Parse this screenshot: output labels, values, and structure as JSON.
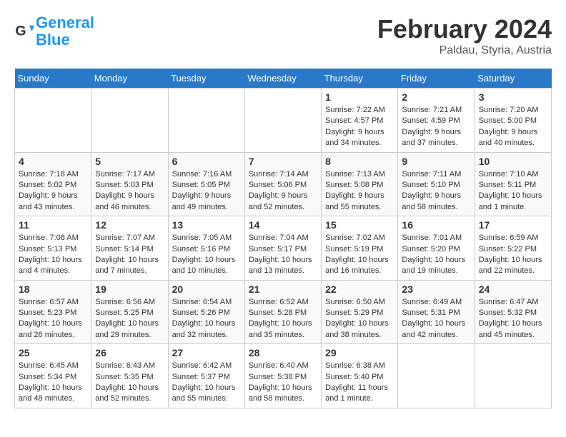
{
  "header": {
    "logo_line1": "General",
    "logo_line2": "Blue",
    "title": "February 2024",
    "subtitle": "Paldau, Styria, Austria"
  },
  "days_of_week": [
    "Sunday",
    "Monday",
    "Tuesday",
    "Wednesday",
    "Thursday",
    "Friday",
    "Saturday"
  ],
  "weeks": [
    [
      {
        "day": "",
        "info": ""
      },
      {
        "day": "",
        "info": ""
      },
      {
        "day": "",
        "info": ""
      },
      {
        "day": "",
        "info": ""
      },
      {
        "day": "1",
        "info": "Sunrise: 7:22 AM\nSunset: 4:57 PM\nDaylight: 9 hours\nand 34 minutes."
      },
      {
        "day": "2",
        "info": "Sunrise: 7:21 AM\nSunset: 4:59 PM\nDaylight: 9 hours\nand 37 minutes."
      },
      {
        "day": "3",
        "info": "Sunrise: 7:20 AM\nSunset: 5:00 PM\nDaylight: 9 hours\nand 40 minutes."
      }
    ],
    [
      {
        "day": "4",
        "info": "Sunrise: 7:18 AM\nSunset: 5:02 PM\nDaylight: 9 hours\nand 43 minutes."
      },
      {
        "day": "5",
        "info": "Sunrise: 7:17 AM\nSunset: 5:03 PM\nDaylight: 9 hours\nand 46 minutes."
      },
      {
        "day": "6",
        "info": "Sunrise: 7:16 AM\nSunset: 5:05 PM\nDaylight: 9 hours\nand 49 minutes."
      },
      {
        "day": "7",
        "info": "Sunrise: 7:14 AM\nSunset: 5:06 PM\nDaylight: 9 hours\nand 52 minutes."
      },
      {
        "day": "8",
        "info": "Sunrise: 7:13 AM\nSunset: 5:08 PM\nDaylight: 9 hours\nand 55 minutes."
      },
      {
        "day": "9",
        "info": "Sunrise: 7:11 AM\nSunset: 5:10 PM\nDaylight: 9 hours\nand 58 minutes."
      },
      {
        "day": "10",
        "info": "Sunrise: 7:10 AM\nSunset: 5:11 PM\nDaylight: 10 hours\nand 1 minute."
      }
    ],
    [
      {
        "day": "11",
        "info": "Sunrise: 7:08 AM\nSunset: 5:13 PM\nDaylight: 10 hours\nand 4 minutes."
      },
      {
        "day": "12",
        "info": "Sunrise: 7:07 AM\nSunset: 5:14 PM\nDaylight: 10 hours\nand 7 minutes."
      },
      {
        "day": "13",
        "info": "Sunrise: 7:05 AM\nSunset: 5:16 PM\nDaylight: 10 hours\nand 10 minutes."
      },
      {
        "day": "14",
        "info": "Sunrise: 7:04 AM\nSunset: 5:17 PM\nDaylight: 10 hours\nand 13 minutes."
      },
      {
        "day": "15",
        "info": "Sunrise: 7:02 AM\nSunset: 5:19 PM\nDaylight: 10 hours\nand 16 minutes."
      },
      {
        "day": "16",
        "info": "Sunrise: 7:01 AM\nSunset: 5:20 PM\nDaylight: 10 hours\nand 19 minutes."
      },
      {
        "day": "17",
        "info": "Sunrise: 6:59 AM\nSunset: 5:22 PM\nDaylight: 10 hours\nand 22 minutes."
      }
    ],
    [
      {
        "day": "18",
        "info": "Sunrise: 6:57 AM\nSunset: 5:23 PM\nDaylight: 10 hours\nand 26 minutes."
      },
      {
        "day": "19",
        "info": "Sunrise: 6:56 AM\nSunset: 5:25 PM\nDaylight: 10 hours\nand 29 minutes."
      },
      {
        "day": "20",
        "info": "Sunrise: 6:54 AM\nSunset: 5:26 PM\nDaylight: 10 hours\nand 32 minutes."
      },
      {
        "day": "21",
        "info": "Sunrise: 6:52 AM\nSunset: 5:28 PM\nDaylight: 10 hours\nand 35 minutes."
      },
      {
        "day": "22",
        "info": "Sunrise: 6:50 AM\nSunset: 5:29 PM\nDaylight: 10 hours\nand 38 minutes."
      },
      {
        "day": "23",
        "info": "Sunrise: 6:49 AM\nSunset: 5:31 PM\nDaylight: 10 hours\nand 42 minutes."
      },
      {
        "day": "24",
        "info": "Sunrise: 6:47 AM\nSunset: 5:32 PM\nDaylight: 10 hours\nand 45 minutes."
      }
    ],
    [
      {
        "day": "25",
        "info": "Sunrise: 6:45 AM\nSunset: 5:34 PM\nDaylight: 10 hours\nand 48 minutes."
      },
      {
        "day": "26",
        "info": "Sunrise: 6:43 AM\nSunset: 5:35 PM\nDaylight: 10 hours\nand 52 minutes."
      },
      {
        "day": "27",
        "info": "Sunrise: 6:42 AM\nSunset: 5:37 PM\nDaylight: 10 hours\nand 55 minutes."
      },
      {
        "day": "28",
        "info": "Sunrise: 6:40 AM\nSunset: 5:38 PM\nDaylight: 10 hours\nand 58 minutes."
      },
      {
        "day": "29",
        "info": "Sunrise: 6:38 AM\nSunset: 5:40 PM\nDaylight: 11 hours\nand 1 minute."
      },
      {
        "day": "",
        "info": ""
      },
      {
        "day": "",
        "info": ""
      }
    ]
  ]
}
